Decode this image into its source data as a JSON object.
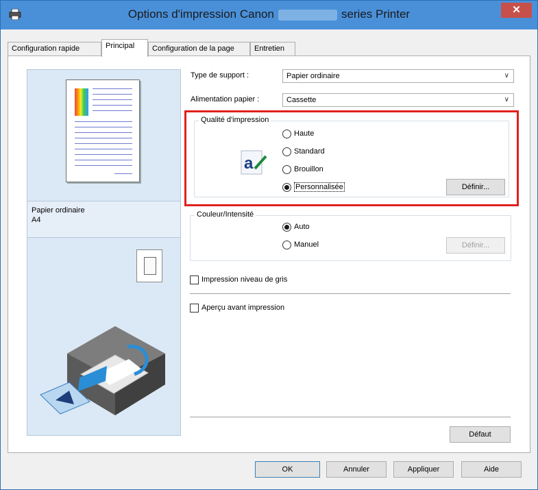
{
  "window": {
    "title_prefix": "Options d'impression Canon",
    "title_suffix": "series Printer",
    "close_symbol": "✕",
    "accent_color": "#4a90d9",
    "highlight_color": "#e0201c"
  },
  "tabs": [
    {
      "label": "Configuration rapide",
      "active": false
    },
    {
      "label": "Principal",
      "active": true
    },
    {
      "label": "Configuration de la page",
      "active": false
    },
    {
      "label": "Entretien",
      "active": false
    }
  ],
  "preview": {
    "paper_type": "Papier ordinaire",
    "paper_size": "A4"
  },
  "media": {
    "type_label": "Type de support :",
    "type_value": "Papier ordinaire",
    "source_label": "Alimentation papier :",
    "source_value": "Cassette"
  },
  "quality": {
    "group_label": "Qualité d'impression",
    "options": [
      "Haute",
      "Standard",
      "Brouillon",
      "Personnalisée"
    ],
    "selected": "Personnalisée",
    "define_label": "Définir..."
  },
  "color": {
    "group_label": "Couleur/Intensité",
    "options": [
      "Auto",
      "Manuel"
    ],
    "selected": "Auto",
    "define_label": "Définir..."
  },
  "checkboxes": {
    "grayscale": "Impression niveau de gris",
    "preview": "Aperçu avant impression"
  },
  "buttons": {
    "default": "Défaut",
    "ok": "OK",
    "cancel": "Annuler",
    "apply": "Appliquer",
    "help": "Aide"
  },
  "icons": [
    "printer-icon",
    "close-icon",
    "quality-pen-icon",
    "orientation-icon",
    "printer-illustration"
  ]
}
